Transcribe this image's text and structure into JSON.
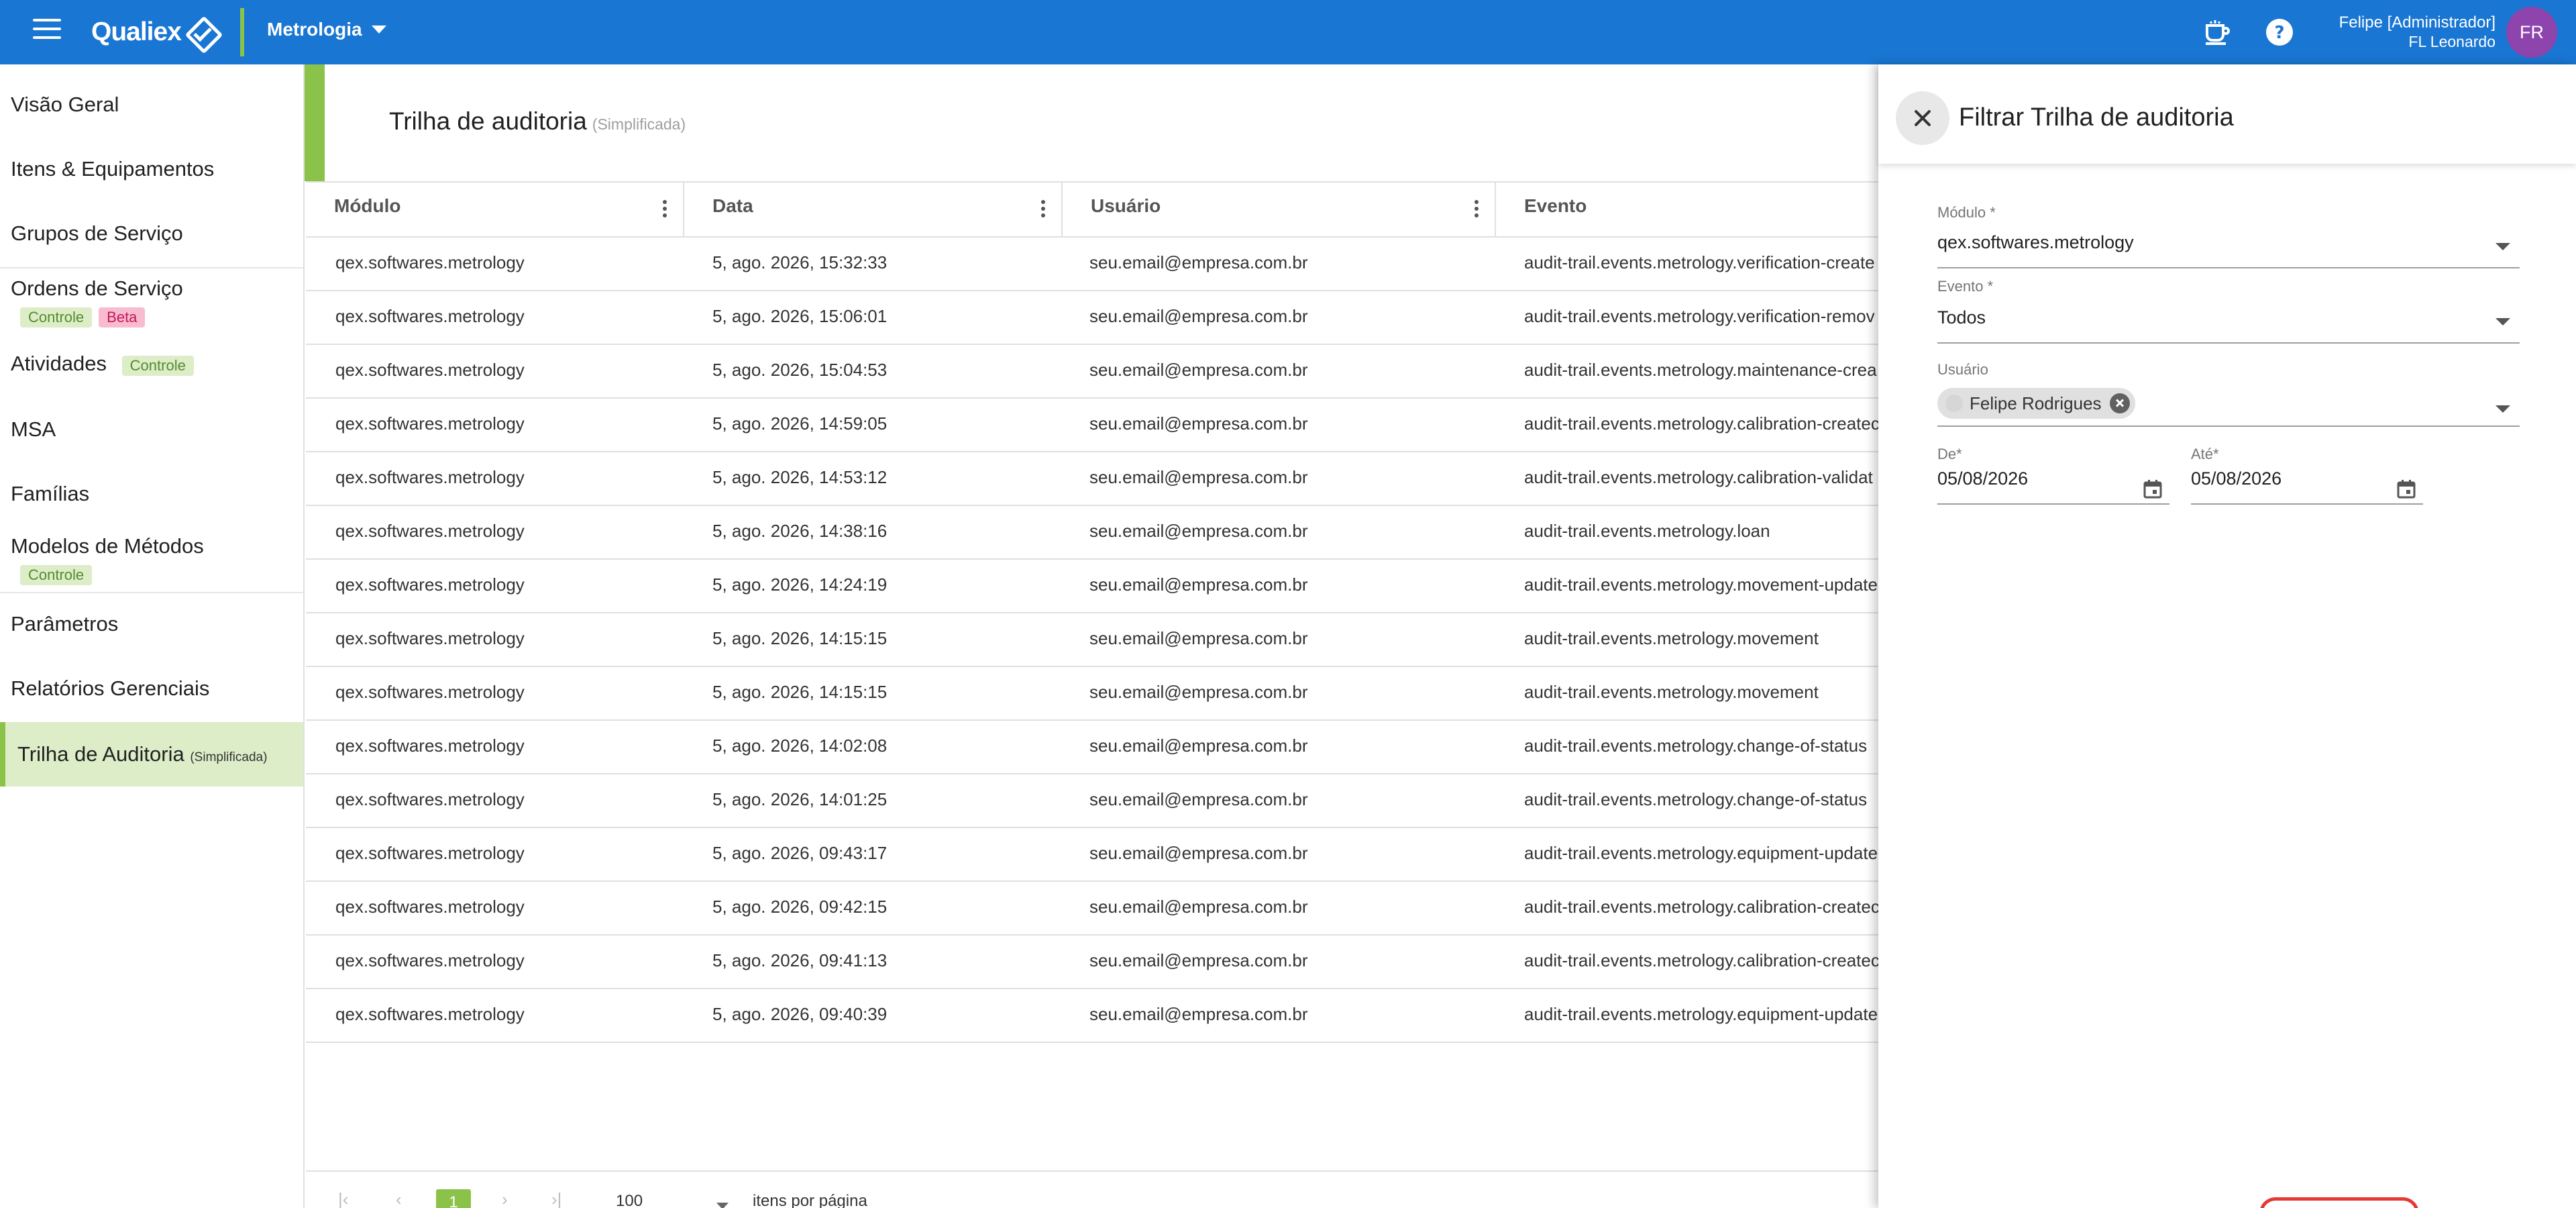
{
  "app": {
    "logo": "Qualiex",
    "module": "Metrologia",
    "user": {
      "name": "Felipe [Administrador]",
      "company": "FL Leonardo",
      "initials": "FR"
    }
  },
  "sidebar": {
    "items": [
      {
        "label": "Visão Geral"
      },
      {
        "label": "Itens & Equipamentos"
      },
      {
        "label": "Grupos de Serviço"
      },
      {
        "label": "Ordens de Serviço",
        "badges": [
          "Controle",
          "Beta"
        ]
      },
      {
        "label": "Atividades",
        "badges": [
          "Controle"
        ]
      },
      {
        "label": "MSA"
      },
      {
        "label": "Famílias"
      },
      {
        "label": "Modelos de Métodos",
        "badges": [
          "Controle"
        ]
      },
      {
        "label": "Parâmetros"
      },
      {
        "label": "Relatórios Gerenciais"
      },
      {
        "label": "Trilha de Auditoria",
        "small": "(Simplificada)"
      }
    ]
  },
  "page": {
    "title": "Trilha de auditoria",
    "subtitle": "(Simplificada)"
  },
  "table": {
    "columns": [
      "Módulo",
      "Data",
      "Usuário",
      "Evento"
    ],
    "rows": [
      [
        "qex.softwares.metrology",
        "5, ago. 2026, 15:32:33",
        "seu.email@empresa.com.br",
        "audit-trail.events.metrology.verification-create"
      ],
      [
        "qex.softwares.metrology",
        "5, ago. 2026, 15:06:01",
        "seu.email@empresa.com.br",
        "audit-trail.events.metrology.verification-remov"
      ],
      [
        "qex.softwares.metrology",
        "5, ago. 2026, 15:04:53",
        "seu.email@empresa.com.br",
        "audit-trail.events.metrology.maintenance-crea"
      ],
      [
        "qex.softwares.metrology",
        "5, ago. 2026, 14:59:05",
        "seu.email@empresa.com.br",
        "audit-trail.events.metrology.calibration-createc"
      ],
      [
        "qex.softwares.metrology",
        "5, ago. 2026, 14:53:12",
        "seu.email@empresa.com.br",
        "audit-trail.events.metrology.calibration-validat"
      ],
      [
        "qex.softwares.metrology",
        "5, ago. 2026, 14:38:16",
        "seu.email@empresa.com.br",
        "audit-trail.events.metrology.loan"
      ],
      [
        "qex.softwares.metrology",
        "5, ago. 2026, 14:24:19",
        "seu.email@empresa.com.br",
        "audit-trail.events.metrology.movement-update"
      ],
      [
        "qex.softwares.metrology",
        "5, ago. 2026, 14:15:15",
        "seu.email@empresa.com.br",
        "audit-trail.events.metrology.movement"
      ],
      [
        "qex.softwares.metrology",
        "5, ago. 2026, 14:15:15",
        "seu.email@empresa.com.br",
        "audit-trail.events.metrology.movement"
      ],
      [
        "qex.softwares.metrology",
        "5, ago. 2026, 14:02:08",
        "seu.email@empresa.com.br",
        "audit-trail.events.metrology.change-of-status"
      ],
      [
        "qex.softwares.metrology",
        "5, ago. 2026, 14:01:25",
        "seu.email@empresa.com.br",
        "audit-trail.events.metrology.change-of-status"
      ],
      [
        "qex.softwares.metrology",
        "5, ago. 2026, 09:43:17",
        "seu.email@empresa.com.br",
        "audit-trail.events.metrology.equipment-update"
      ],
      [
        "qex.softwares.metrology",
        "5, ago. 2026, 09:42:15",
        "seu.email@empresa.com.br",
        "audit-trail.events.metrology.calibration-createc"
      ],
      [
        "qex.softwares.metrology",
        "5, ago. 2026, 09:41:13",
        "seu.email@empresa.com.br",
        "audit-trail.events.metrology.calibration-createc"
      ],
      [
        "qex.softwares.metrology",
        "5, ago. 2026, 09:40:39",
        "seu.email@empresa.com.br",
        "audit-trail.events.metrology.equipment-update"
      ]
    ]
  },
  "pagination": {
    "current_page": "1",
    "page_size": "100",
    "page_size_label": "itens por página"
  },
  "filter": {
    "title": "Filtrar Trilha de auditoria",
    "modulo_label": "Módulo *",
    "modulo_value": "qex.softwares.metrology",
    "evento_label": "Evento *",
    "evento_value": "Todos",
    "usuario_label": "Usuário",
    "usuario_chip": "Felipe Rodrigues",
    "de_label": "De*",
    "de_value": "05/08/2026",
    "ate_label": "Até*",
    "ate_value": "05/08/2026"
  },
  "colors": {
    "topbar": "#1976d2",
    "accent_green": "#8bc34a",
    "active_bg": "#dcedc8",
    "avatar": "#8e44ad",
    "apply_button_border": "#e53935"
  },
  "icons": [
    "menu-icon",
    "logo-icon",
    "chevron-down-icon",
    "coffee-cup-icon",
    "help-icon",
    "column-menu-icon",
    "close-icon",
    "calendar-icon",
    "chip-remove-icon"
  ]
}
